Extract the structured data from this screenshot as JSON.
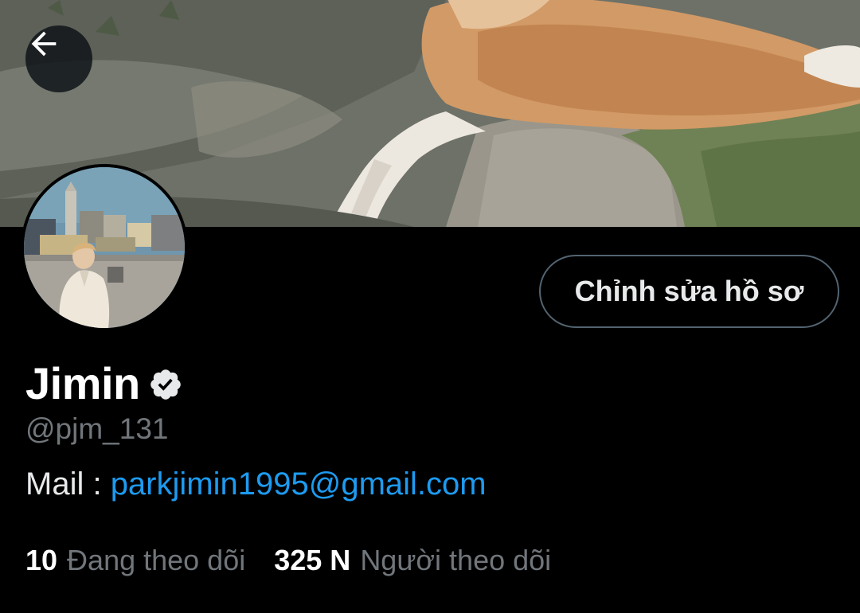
{
  "header": {
    "back_icon": "arrow-left-icon"
  },
  "profile": {
    "display_name": "Jimin",
    "verified_icon": "verified-badge-icon",
    "handle": "@pjm_131",
    "bio_prefix": "Mail : ",
    "bio_link": "parkjimin1995@gmail.com",
    "edit_button_label": "Chỉnh sửa hồ sơ"
  },
  "stats": {
    "following_count": "10",
    "following_label": "Đang theo dõi",
    "followers_count": "325 N",
    "followers_label": "Người theo dõi"
  },
  "colors": {
    "background": "#000000",
    "link": "#1d9bf0",
    "muted_text": "#71767b",
    "button_border": "#536471"
  }
}
